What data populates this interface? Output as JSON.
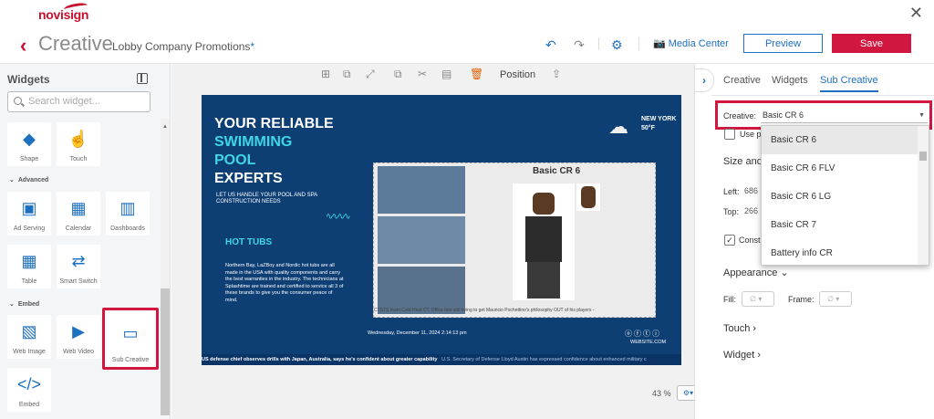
{
  "brand": {
    "logo": "novisign",
    "accent": "#c8102e",
    "primary": "#1e70c1",
    "save_color": "#d1173f"
  },
  "header": {
    "title": "Creative",
    "project_name": "Lobby Company Promotions",
    "unsaved_mark": "*",
    "media_center_label": "Media Center",
    "preview_label": "Preview",
    "save_label": "Save"
  },
  "left_panel": {
    "title": "Widgets",
    "search_placeholder": "Search widget...",
    "top_tiles": [
      {
        "label": "Shape",
        "icon": "shape-icon"
      },
      {
        "label": "Touch",
        "icon": "touch-icon"
      }
    ],
    "advanced_label": "Advanced",
    "advanced_tiles": [
      {
        "label": "Ad Serving",
        "icon": "ad-serving-icon"
      },
      {
        "label": "Calendar",
        "icon": "calendar-icon"
      },
      {
        "label": "Dashboards",
        "icon": "dashboards-icon"
      },
      {
        "label": "Table",
        "icon": "table-icon"
      },
      {
        "label": "Smart Switch",
        "icon": "smart-switch-icon"
      }
    ],
    "embed_label": "Embed",
    "embed_tiles": [
      {
        "label": "Web Image",
        "icon": "web-image-icon"
      },
      {
        "label": "Web Video",
        "icon": "web-video-icon"
      },
      {
        "label": "Sub Creative",
        "icon": "sub-creative-icon"
      },
      {
        "label": "Embed",
        "icon": "embed-icon"
      }
    ]
  },
  "toolbar": {
    "position_label": "Position"
  },
  "slide": {
    "headline_1": "YOUR RELIABLE",
    "headline_2": "SWIMMING",
    "headline_3": "POOL",
    "headline_4": "EXPERTS",
    "tagline": "LET US HANDLE YOUR POOL AND SPA CONSTRUCTION NEEDS",
    "weather_city": "NEW YORK",
    "weather_temp": "50°F",
    "hot_tubs_title": "HOT TUBS",
    "hot_tubs_body": "Northern Bay, LaZBoy and Nordic hot tubs are all made in the USA with quality components and carry the best warranties in the industry. The technicians at Splashtime are trained and certified to service all 3 of these brands to give you the consumer peace of mind.",
    "sub_creative_title": "Basic CR 6",
    "sub_creative_ticker": "CTSTS team Cold Heat CT, Office fate still trying to get Mauricio Pochettino's philosophy OUT of his players - ",
    "date_text": "Wednesday, December 11, 2024 2:14:13 pm",
    "website": "WEBSITE.COM",
    "ticker_bold": "US defense chief observes drills with Japan, Australia, says he's confident about greater capability",
    "ticker_regular": "U.S. Secretary of Defense Lloyd Austin has expressed confidence about enhanced military c"
  },
  "canvas": {
    "zoom": "43 %"
  },
  "right_panel": {
    "tabs": [
      "Creative",
      "Widgets",
      "Sub Creative"
    ],
    "active_tab": "Sub Creative",
    "creative_label": "Creative:",
    "creative_value": "Basic CR 6",
    "use_label": "Use p",
    "size_label": "Size and",
    "left_label": "Left:",
    "left_value": "686",
    "top_label": "Top:",
    "top_value": "266",
    "const_label": "Const",
    "appearance_label": "Appearance",
    "fill_label": "Fill:",
    "frame_label": "Frame:",
    "fill_value": "∅",
    "frame_value": "∅",
    "touch_label": "Touch",
    "widget_label": "Widget",
    "dropdown_options": [
      "Basic CR 6",
      "Basic CR 6 FLV",
      "Basic CR 6 LG",
      "Basic CR 7",
      "Battery info CR"
    ]
  }
}
